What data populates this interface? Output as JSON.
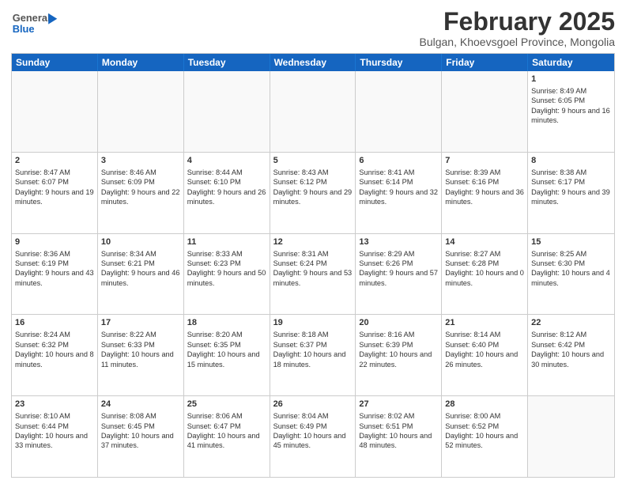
{
  "logo": {
    "line1": "General",
    "line2": "Blue"
  },
  "title": "February 2025",
  "location": "Bulgan, Khoevsgoel Province, Mongolia",
  "days_of_week": [
    "Sunday",
    "Monday",
    "Tuesday",
    "Wednesday",
    "Thursday",
    "Friday",
    "Saturday"
  ],
  "weeks": [
    [
      {
        "day": "",
        "info": ""
      },
      {
        "day": "",
        "info": ""
      },
      {
        "day": "",
        "info": ""
      },
      {
        "day": "",
        "info": ""
      },
      {
        "day": "",
        "info": ""
      },
      {
        "day": "",
        "info": ""
      },
      {
        "day": "1",
        "info": "Sunrise: 8:49 AM\nSunset: 6:05 PM\nDaylight: 9 hours and 16 minutes."
      }
    ],
    [
      {
        "day": "2",
        "info": "Sunrise: 8:47 AM\nSunset: 6:07 PM\nDaylight: 9 hours and 19 minutes."
      },
      {
        "day": "3",
        "info": "Sunrise: 8:46 AM\nSunset: 6:09 PM\nDaylight: 9 hours and 22 minutes."
      },
      {
        "day": "4",
        "info": "Sunrise: 8:44 AM\nSunset: 6:10 PM\nDaylight: 9 hours and 26 minutes."
      },
      {
        "day": "5",
        "info": "Sunrise: 8:43 AM\nSunset: 6:12 PM\nDaylight: 9 hours and 29 minutes."
      },
      {
        "day": "6",
        "info": "Sunrise: 8:41 AM\nSunset: 6:14 PM\nDaylight: 9 hours and 32 minutes."
      },
      {
        "day": "7",
        "info": "Sunrise: 8:39 AM\nSunset: 6:16 PM\nDaylight: 9 hours and 36 minutes."
      },
      {
        "day": "8",
        "info": "Sunrise: 8:38 AM\nSunset: 6:17 PM\nDaylight: 9 hours and 39 minutes."
      }
    ],
    [
      {
        "day": "9",
        "info": "Sunrise: 8:36 AM\nSunset: 6:19 PM\nDaylight: 9 hours and 43 minutes."
      },
      {
        "day": "10",
        "info": "Sunrise: 8:34 AM\nSunset: 6:21 PM\nDaylight: 9 hours and 46 minutes."
      },
      {
        "day": "11",
        "info": "Sunrise: 8:33 AM\nSunset: 6:23 PM\nDaylight: 9 hours and 50 minutes."
      },
      {
        "day": "12",
        "info": "Sunrise: 8:31 AM\nSunset: 6:24 PM\nDaylight: 9 hours and 53 minutes."
      },
      {
        "day": "13",
        "info": "Sunrise: 8:29 AM\nSunset: 6:26 PM\nDaylight: 9 hours and 57 minutes."
      },
      {
        "day": "14",
        "info": "Sunrise: 8:27 AM\nSunset: 6:28 PM\nDaylight: 10 hours and 0 minutes."
      },
      {
        "day": "15",
        "info": "Sunrise: 8:25 AM\nSunset: 6:30 PM\nDaylight: 10 hours and 4 minutes."
      }
    ],
    [
      {
        "day": "16",
        "info": "Sunrise: 8:24 AM\nSunset: 6:32 PM\nDaylight: 10 hours and 8 minutes."
      },
      {
        "day": "17",
        "info": "Sunrise: 8:22 AM\nSunset: 6:33 PM\nDaylight: 10 hours and 11 minutes."
      },
      {
        "day": "18",
        "info": "Sunrise: 8:20 AM\nSunset: 6:35 PM\nDaylight: 10 hours and 15 minutes."
      },
      {
        "day": "19",
        "info": "Sunrise: 8:18 AM\nSunset: 6:37 PM\nDaylight: 10 hours and 18 minutes."
      },
      {
        "day": "20",
        "info": "Sunrise: 8:16 AM\nSunset: 6:39 PM\nDaylight: 10 hours and 22 minutes."
      },
      {
        "day": "21",
        "info": "Sunrise: 8:14 AM\nSunset: 6:40 PM\nDaylight: 10 hours and 26 minutes."
      },
      {
        "day": "22",
        "info": "Sunrise: 8:12 AM\nSunset: 6:42 PM\nDaylight: 10 hours and 30 minutes."
      }
    ],
    [
      {
        "day": "23",
        "info": "Sunrise: 8:10 AM\nSunset: 6:44 PM\nDaylight: 10 hours and 33 minutes."
      },
      {
        "day": "24",
        "info": "Sunrise: 8:08 AM\nSunset: 6:45 PM\nDaylight: 10 hours and 37 minutes."
      },
      {
        "day": "25",
        "info": "Sunrise: 8:06 AM\nSunset: 6:47 PM\nDaylight: 10 hours and 41 minutes."
      },
      {
        "day": "26",
        "info": "Sunrise: 8:04 AM\nSunset: 6:49 PM\nDaylight: 10 hours and 45 minutes."
      },
      {
        "day": "27",
        "info": "Sunrise: 8:02 AM\nSunset: 6:51 PM\nDaylight: 10 hours and 48 minutes."
      },
      {
        "day": "28",
        "info": "Sunrise: 8:00 AM\nSunset: 6:52 PM\nDaylight: 10 hours and 52 minutes."
      },
      {
        "day": "",
        "info": ""
      }
    ]
  ]
}
